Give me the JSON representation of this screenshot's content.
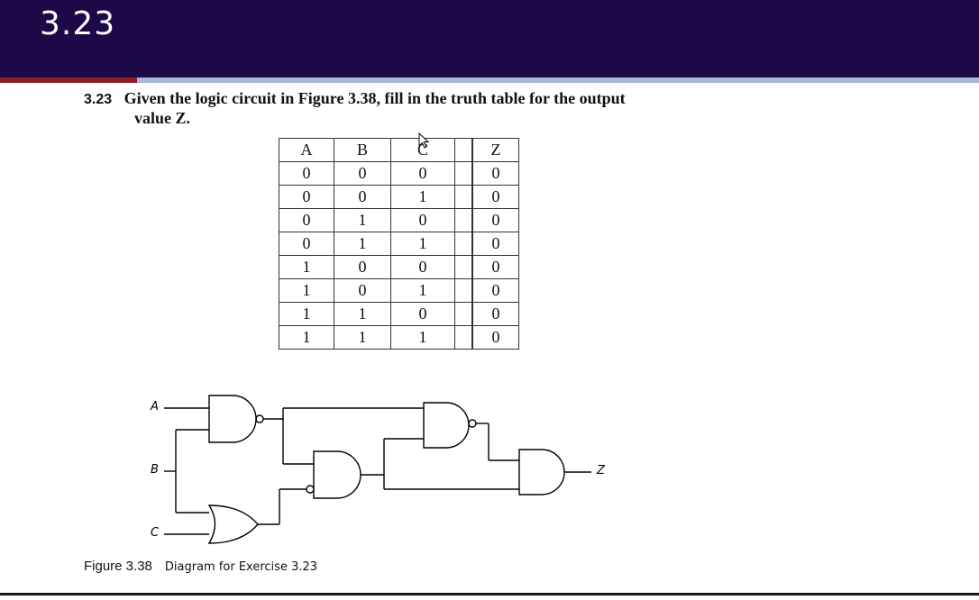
{
  "slide": {
    "title": "3.23",
    "colors": {
      "header": "#1d0848",
      "accent_red": "#8c1b22",
      "accent_blue": "#a9b8d9"
    }
  },
  "problem": {
    "number": "3.23",
    "line1": "Given the logic circuit in Figure 3.38, fill in the truth table for the output",
    "line2": "value Z."
  },
  "truth_table": {
    "headers": [
      "A",
      "B",
      "C",
      "Z"
    ],
    "rows": [
      [
        "0",
        "0",
        "0",
        "0"
      ],
      [
        "0",
        "0",
        "1",
        "0"
      ],
      [
        "0",
        "1",
        "0",
        "0"
      ],
      [
        "0",
        "1",
        "1",
        "0"
      ],
      [
        "1",
        "0",
        "0",
        "0"
      ],
      [
        "1",
        "0",
        "1",
        "0"
      ],
      [
        "1",
        "1",
        "0",
        "0"
      ],
      [
        "1",
        "1",
        "1",
        "0"
      ]
    ]
  },
  "circuit": {
    "inputs": [
      "A",
      "B",
      "C"
    ],
    "output": "Z"
  },
  "figure": {
    "label": "Figure 3.38",
    "description": "Diagram for Exercise 3.23"
  }
}
